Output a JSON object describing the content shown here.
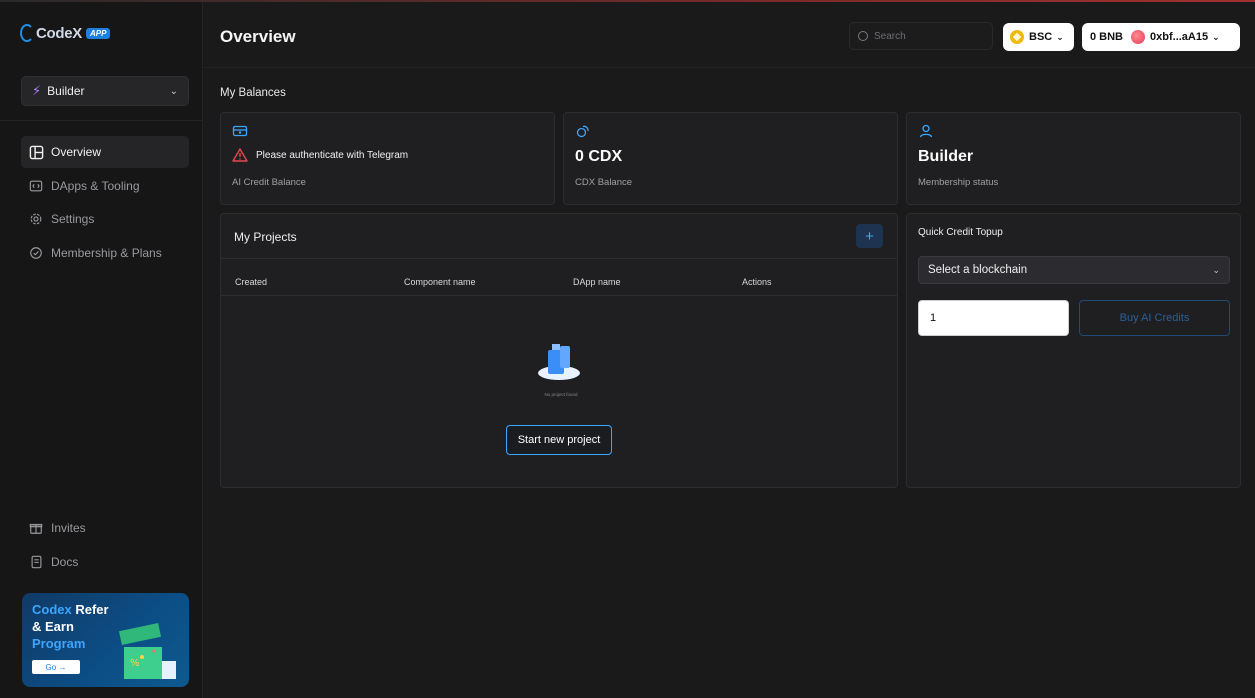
{
  "brand": {
    "name": "CodeX",
    "badge": "APP"
  },
  "sidebar": {
    "workspace_select": "Builder",
    "nav": [
      {
        "label": "Overview",
        "icon": "layout-icon",
        "active": true
      },
      {
        "label": "DApps & Tooling",
        "icon": "code-icon",
        "active": false
      },
      {
        "label": "Settings",
        "icon": "gear-icon",
        "active": false
      },
      {
        "label": "Membership & Plans",
        "icon": "check-circle-icon",
        "active": false
      }
    ],
    "bottom_nav": [
      {
        "label": "Invites",
        "icon": "gift-icon"
      },
      {
        "label": "Docs",
        "icon": "document-icon"
      }
    ],
    "promo": {
      "line1a": "Codex",
      "line1b": "Refer",
      "line2": "& Earn",
      "line3": "Program",
      "button": "Go →"
    }
  },
  "header": {
    "title": "Overview",
    "search_placeholder": "Search",
    "chain": "BSC",
    "balance": "0 BNB",
    "address": "0xbf...aA15"
  },
  "balances": {
    "section_title": "My Balances",
    "ai_credit": {
      "warning": "Please authenticate with Telegram",
      "label": "AI Credit Balance"
    },
    "cdx": {
      "value": "0 CDX",
      "label": "CDX Balance"
    },
    "membership": {
      "value": "Builder",
      "label": "Membership status"
    }
  },
  "projects": {
    "title": "My Projects",
    "columns": [
      "Created",
      "Component name",
      "DApp name",
      "Actions"
    ],
    "empty_text": "No project found",
    "start_button": "Start new project"
  },
  "topup": {
    "title": "Quick Credit Topup",
    "select_value": "Select a blockchain",
    "amount_value": "1",
    "buy_button": "Buy AI Credits"
  },
  "colors": {
    "accent": "#3ba6ff",
    "background": "#1a1a1b",
    "card": "#1f1f21",
    "warning": "#e5484d"
  }
}
